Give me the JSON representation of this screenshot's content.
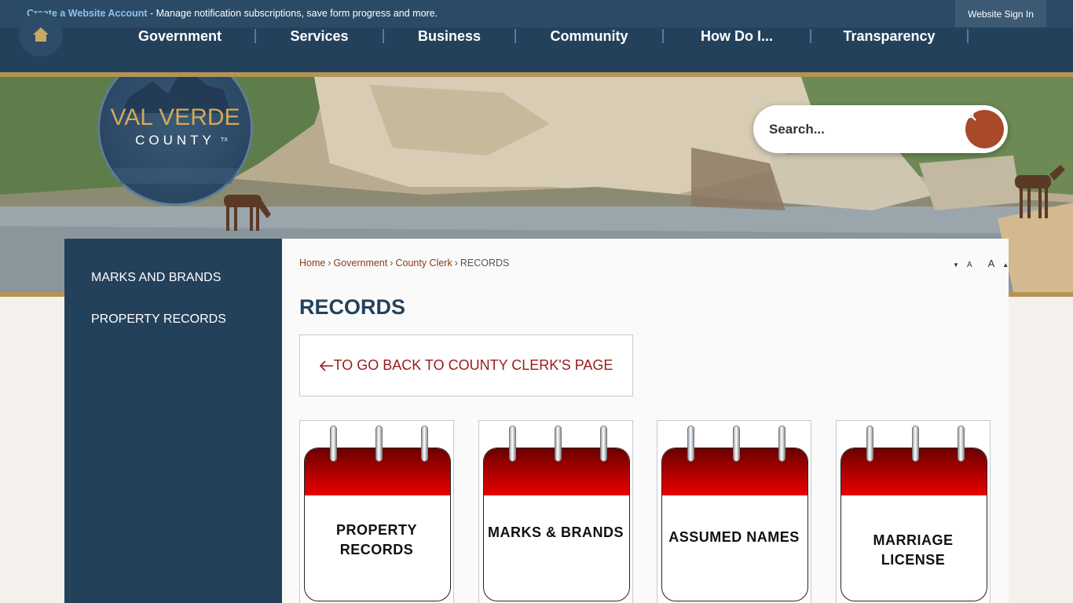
{
  "topbar": {
    "account_link": "Create a Website Account",
    "message": " - Manage notification subscriptions, save form progress and more.",
    "signin": "Website Sign In"
  },
  "nav": {
    "items": [
      "Government",
      "Services",
      "Business",
      "Community",
      "How Do I...",
      "Transparency"
    ]
  },
  "logo": {
    "line1": "VAL VERDE",
    "line2": "COUNTY",
    "state": "TX"
  },
  "search": {
    "placeholder": "Search..."
  },
  "sidebar": {
    "items": [
      "MARKS AND BRANDS",
      "PROPERTY RECORDS"
    ]
  },
  "breadcrumb": {
    "home": "Home",
    "government": "Government",
    "clerk": "County Clerk",
    "current": "RECORDS"
  },
  "resize": {
    "smaller": "A",
    "larger": "A"
  },
  "page": {
    "title": "RECORDS",
    "back_link": "TO GO BACK TO COUNTY CLERK'S PAGE"
  },
  "cards": [
    {
      "line1": "PROPERTY",
      "line2": "RECORDS"
    },
    {
      "line1": "MARKS & BRANDS",
      "line2": ""
    },
    {
      "line1": "ASSUMED NAMES",
      "line2": ""
    },
    {
      "line1": "MARRIAGE",
      "line2": "LICENSE"
    }
  ],
  "colors": {
    "navy": "#24415c",
    "gold": "#b39454",
    "accent": "#a8492a",
    "link": "#8e3a1c"
  }
}
